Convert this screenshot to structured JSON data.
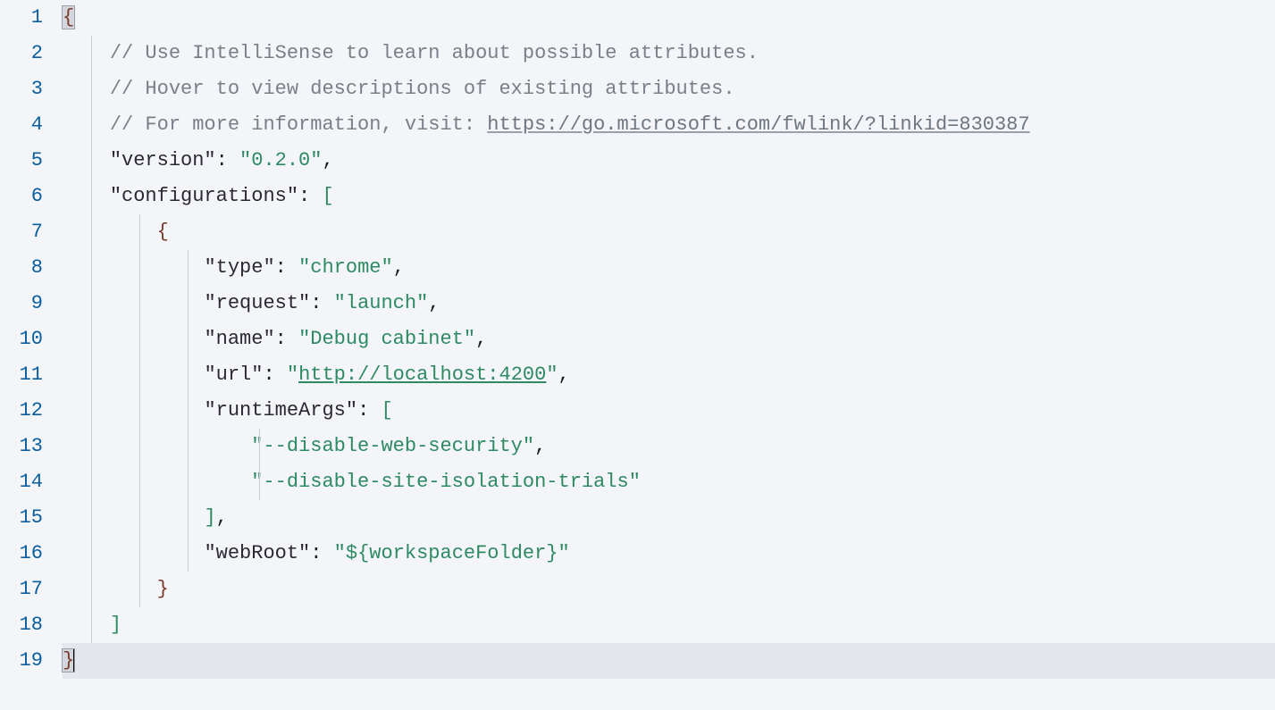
{
  "lineCount": 19,
  "currentLine": 19,
  "indentUnit": "    ",
  "lines": {
    "1": {
      "tokens": [
        {
          "cls": "tok-brace bracket-match",
          "t": "{"
        }
      ]
    },
    "2": {
      "tokens": [
        {
          "cls": "indent",
          "t": "    "
        },
        {
          "cls": "tok-comment",
          "t": "// Use IntelliSense to learn about possible attributes."
        }
      ]
    },
    "3": {
      "tokens": [
        {
          "cls": "indent",
          "t": "    "
        },
        {
          "cls": "tok-comment",
          "t": "// Hover to view descriptions of existing attributes."
        }
      ]
    },
    "4": {
      "tokens": [
        {
          "cls": "indent",
          "t": "    "
        },
        {
          "cls": "tok-comment",
          "t": "// For more information, visit: "
        },
        {
          "cls": "tok-link",
          "t": "https://go.microsoft.com/fwlink/?linkid=830387"
        }
      ]
    },
    "5": {
      "tokens": [
        {
          "cls": "indent",
          "t": "    "
        },
        {
          "cls": "tok-key",
          "t": "\"version\""
        },
        {
          "cls": "tok-punc",
          "t": ": "
        },
        {
          "cls": "tok-str",
          "t": "\"0.2.0\""
        },
        {
          "cls": "tok-punc",
          "t": ","
        }
      ]
    },
    "6": {
      "tokens": [
        {
          "cls": "indent",
          "t": "    "
        },
        {
          "cls": "tok-key",
          "t": "\"configurations\""
        },
        {
          "cls": "tok-punc",
          "t": ": "
        },
        {
          "cls": "tok-bracket",
          "t": "["
        }
      ]
    },
    "7": {
      "tokens": [
        {
          "cls": "indent",
          "t": "        "
        },
        {
          "cls": "tok-brace",
          "t": "{"
        }
      ]
    },
    "8": {
      "tokens": [
        {
          "cls": "indent",
          "t": "            "
        },
        {
          "cls": "tok-key",
          "t": "\"type\""
        },
        {
          "cls": "tok-punc",
          "t": ": "
        },
        {
          "cls": "tok-str",
          "t": "\"chrome\""
        },
        {
          "cls": "tok-punc",
          "t": ","
        }
      ]
    },
    "9": {
      "tokens": [
        {
          "cls": "indent",
          "t": "            "
        },
        {
          "cls": "tok-key",
          "t": "\"request\""
        },
        {
          "cls": "tok-punc",
          "t": ": "
        },
        {
          "cls": "tok-str",
          "t": "\"launch\""
        },
        {
          "cls": "tok-punc",
          "t": ","
        }
      ]
    },
    "10": {
      "tokens": [
        {
          "cls": "indent",
          "t": "            "
        },
        {
          "cls": "tok-key",
          "t": "\"name\""
        },
        {
          "cls": "tok-punc",
          "t": ": "
        },
        {
          "cls": "tok-str",
          "t": "\"Debug cabinet\""
        },
        {
          "cls": "tok-punc",
          "t": ","
        }
      ]
    },
    "11": {
      "tokens": [
        {
          "cls": "indent",
          "t": "            "
        },
        {
          "cls": "tok-key",
          "t": "\"url\""
        },
        {
          "cls": "tok-punc",
          "t": ": "
        },
        {
          "cls": "tok-str",
          "t": "\""
        },
        {
          "cls": "tok-strlink",
          "t": "http://localhost:4200"
        },
        {
          "cls": "tok-str",
          "t": "\""
        },
        {
          "cls": "tok-punc",
          "t": ","
        }
      ]
    },
    "12": {
      "tokens": [
        {
          "cls": "indent",
          "t": "            "
        },
        {
          "cls": "tok-key",
          "t": "\"runtimeArgs\""
        },
        {
          "cls": "tok-punc",
          "t": ": "
        },
        {
          "cls": "tok-bracket",
          "t": "["
        }
      ]
    },
    "13": {
      "tokens": [
        {
          "cls": "indent",
          "t": "                "
        },
        {
          "cls": "tok-str",
          "t": "\"--disable-web-security\""
        },
        {
          "cls": "tok-punc",
          "t": ","
        }
      ]
    },
    "14": {
      "tokens": [
        {
          "cls": "indent",
          "t": "                "
        },
        {
          "cls": "tok-str",
          "t": "\"--disable-site-isolation-trials\""
        }
      ]
    },
    "15": {
      "tokens": [
        {
          "cls": "indent",
          "t": "            "
        },
        {
          "cls": "tok-bracket",
          "t": "]"
        },
        {
          "cls": "tok-punc",
          "t": ","
        }
      ]
    },
    "16": {
      "tokens": [
        {
          "cls": "indent",
          "t": "            "
        },
        {
          "cls": "tok-key",
          "t": "\"webRoot\""
        },
        {
          "cls": "tok-punc",
          "t": ": "
        },
        {
          "cls": "tok-str",
          "t": "\"${workspaceFolder}\""
        }
      ]
    },
    "17": {
      "tokens": [
        {
          "cls": "indent",
          "t": "        "
        },
        {
          "cls": "tok-brace",
          "t": "}"
        }
      ]
    },
    "18": {
      "tokens": [
        {
          "cls": "indent",
          "t": "    "
        },
        {
          "cls": "tok-bracket",
          "t": "]"
        }
      ]
    },
    "19": {
      "tokens": [
        {
          "cls": "tok-brace bracket-match",
          "t": "}"
        }
      ],
      "cursorAfter": true
    }
  },
  "guides": {
    "1": [],
    "2": [
      "g1"
    ],
    "3": [
      "g1"
    ],
    "4": [
      "g1"
    ],
    "5": [
      "g1"
    ],
    "6": [
      "g1"
    ],
    "7": [
      "g1",
      "g2"
    ],
    "8": [
      "g1",
      "g2",
      "g3"
    ],
    "9": [
      "g1",
      "g2",
      "g3"
    ],
    "10": [
      "g1",
      "g2",
      "g3"
    ],
    "11": [
      "g1",
      "g2",
      "g3"
    ],
    "12": [
      "g1",
      "g2",
      "g3"
    ],
    "13": [
      "g1",
      "g2",
      "g3",
      "g4"
    ],
    "14": [
      "g1",
      "g2",
      "g3",
      "g4"
    ],
    "15": [
      "g1",
      "g2",
      "g3"
    ],
    "16": [
      "g1",
      "g2",
      "g3"
    ],
    "17": [
      "g1",
      "g2"
    ],
    "18": [
      "g1"
    ],
    "19": []
  }
}
